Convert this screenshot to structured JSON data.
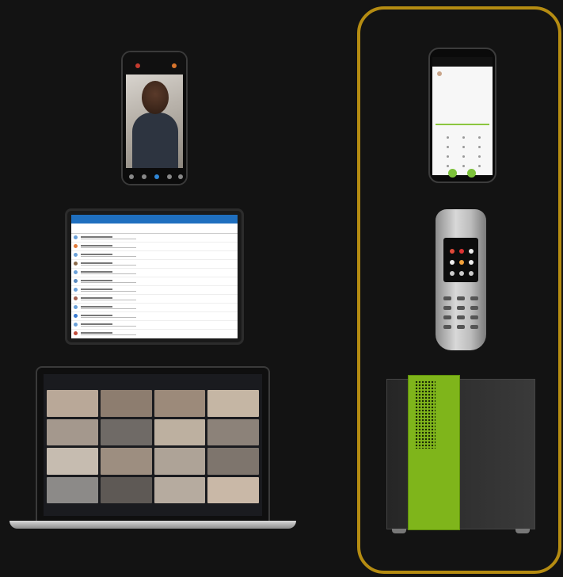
{
  "colors": {
    "background": "#131313",
    "frame": "#b58c12",
    "accent_green": "#7fb51b",
    "tablet_header": "#1f6fbf"
  },
  "devices": {
    "smartphone_video": {
      "icon": "smartphone-icon"
    },
    "tablet_app": {
      "icon": "tablet-icon"
    },
    "laptop_meeting": {
      "icon": "laptop-icon"
    },
    "smartphone_dialer": {
      "icon": "smartphone-icon"
    },
    "dect_handset": {
      "icon": "cordless-phone-icon"
    },
    "pbx_server": {
      "icon": "server-icon"
    }
  }
}
